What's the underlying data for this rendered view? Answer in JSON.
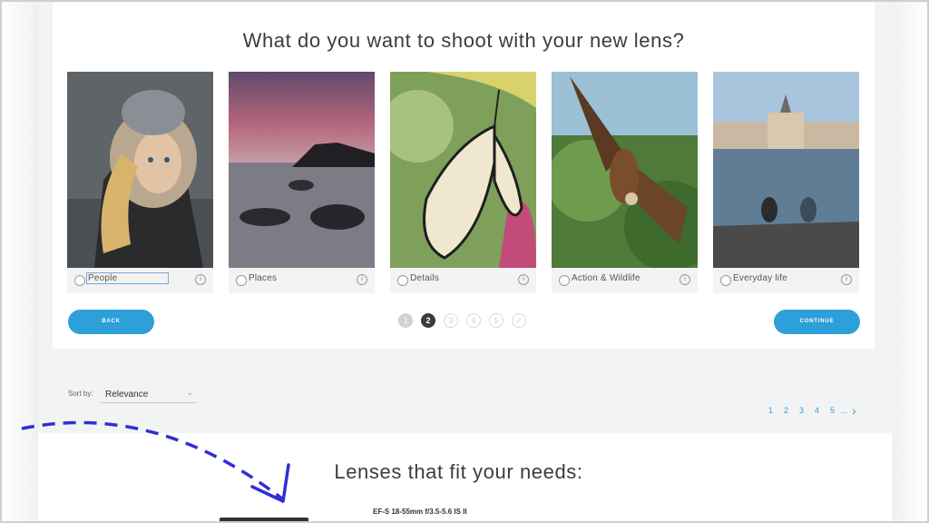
{
  "quiz": {
    "title": "What do you want to shoot with your new lens?",
    "options": [
      {
        "label": "People"
      },
      {
        "label": "Places"
      },
      {
        "label": "Details"
      },
      {
        "label": "Action & Wildlife"
      },
      {
        "label": "Everyday life"
      }
    ],
    "info_glyph": "i",
    "back_label": "BACK",
    "continue_label": "CONTINUE",
    "steps": [
      "1",
      "2",
      "3",
      "4",
      "5",
      "✓"
    ],
    "current_step": 2
  },
  "sort": {
    "label": "Sort by:",
    "value": "Relevance"
  },
  "pagination": {
    "pages": [
      "1",
      "2",
      "3",
      "4",
      "5",
      "..."
    ],
    "next_icon": "chevron-right-icon"
  },
  "results": {
    "title": "Lenses that fit your needs:",
    "first_lens": "EF-S 18-55mm f/3.5-5.6 IS II"
  },
  "colors": {
    "accent": "#2d9fd9",
    "annotation_arrow": "#2f2fd6"
  }
}
